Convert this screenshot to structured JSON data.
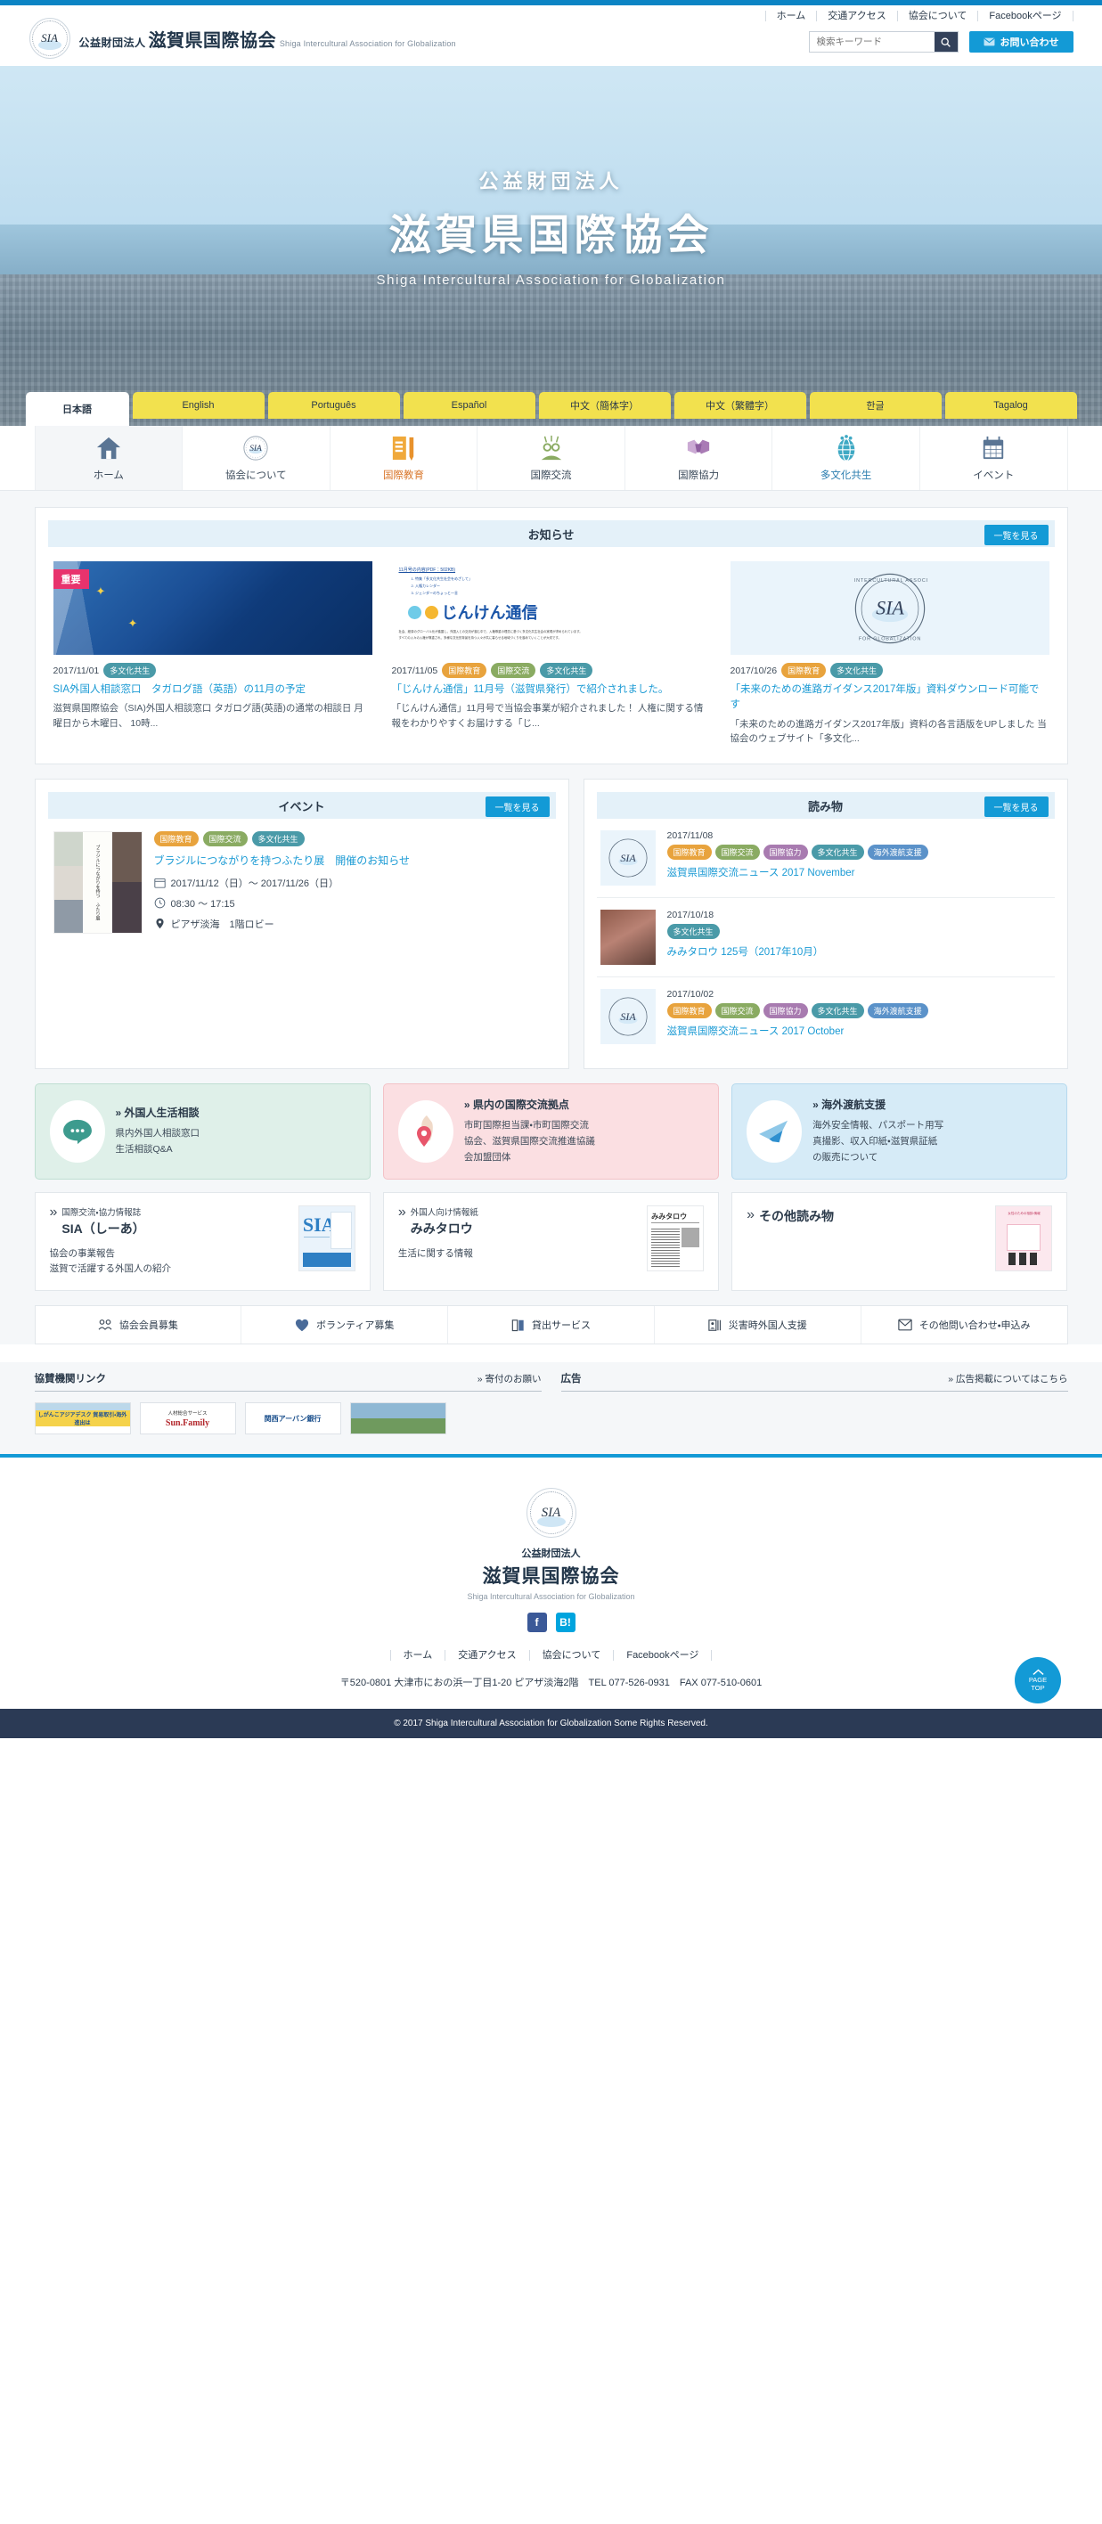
{
  "header": {
    "logo_l1_prefix": "公益財団法人",
    "logo_l1_main": "滋賀県国際協会",
    "logo_l2": "Shiga Intercultural Association for Globalization",
    "nav_links": [
      "ホーム",
      "交通アクセス",
      "協会について",
      "Facebookページ"
    ],
    "search_placeholder": "検索キーワード",
    "search_value": "",
    "contact_label": "お問い合わせ"
  },
  "hero": {
    "line1": "公益財団法人",
    "line2": "滋賀県国際協会",
    "line3": "Shiga Intercultural Association for Globalization",
    "languages": [
      {
        "label": "日本語",
        "active": true
      },
      {
        "label": "English",
        "active": false
      },
      {
        "label": "Português",
        "active": false
      },
      {
        "label": "Español",
        "active": false
      },
      {
        "label": "中文（簡体字）",
        "active": false
      },
      {
        "label": "中文（繁體字）",
        "active": false
      },
      {
        "label": "한글",
        "active": false
      },
      {
        "label": "Tagalog",
        "active": false
      }
    ]
  },
  "gnav": [
    {
      "label": "ホーム",
      "icon": "home-icon",
      "active": true
    },
    {
      "label": "協会について",
      "icon": "sia-seal-icon",
      "active": false
    },
    {
      "label": "国際教育",
      "icon": "book-pencil-icon",
      "active": false
    },
    {
      "label": "国際交流",
      "icon": "people-icon",
      "active": false
    },
    {
      "label": "国際協力",
      "icon": "handshake-icon",
      "active": false
    },
    {
      "label": "多文化共生",
      "icon": "globe-people-icon",
      "active": false
    },
    {
      "label": "イベント",
      "icon": "calendar-icon",
      "active": false
    }
  ],
  "news": {
    "title": "お知らせ",
    "see_all": "一覧を見る",
    "items": [
      {
        "badge": "重要",
        "date": "2017/11/01",
        "tags": [
          {
            "label": "多文化共生",
            "cls": "t-multi"
          }
        ],
        "title": "SIA外国人相談窓口　タガログ語（英語）の11月の予定",
        "desc": "滋賀県国際協会（SIA)外国人相談窓口 タガログ語(英語)の通常の相談日 月曜日から木曜日、 10時...",
        "thumb": "philippines-flag"
      },
      {
        "badge": "",
        "date": "2017/11/05",
        "tags": [
          {
            "label": "国際教育",
            "cls": "t-edu"
          },
          {
            "label": "国際交流",
            "cls": "t-exch"
          },
          {
            "label": "多文化共生",
            "cls": "t-multi"
          }
        ],
        "title": "「じんけん通信」11月号（滋賀県発行）で紹介されました。",
        "desc": "「じんけん通信」11月号で当協会事業が紹介されました！ 人権に関する情報をわかりやすくお届けする「じ...",
        "thumb": "jinken-newsletter"
      },
      {
        "badge": "",
        "date": "2017/10/26",
        "tags": [
          {
            "label": "国際教育",
            "cls": "t-edu"
          },
          {
            "label": "多文化共生",
            "cls": "t-multi"
          }
        ],
        "title": "「未来のための進路ガイダンス2017年版」資料ダウンロード可能です",
        "desc": "「未来のための進路ガイダンス2017年版」資料の各言語版をUPしました 当協会のウェブサイト「多文化...",
        "thumb": "sia-seal"
      }
    ]
  },
  "events": {
    "title": "イベント",
    "see_all": "一覧を見る",
    "item": {
      "tags": [
        {
          "label": "国際教育",
          "cls": "t-edu"
        },
        {
          "label": "国際交流",
          "cls": "t-exch"
        },
        {
          "label": "多文化共生",
          "cls": "t-multi"
        }
      ],
      "title": "ブラジルにつながりを持つふたり展　開催のお知らせ",
      "date": "2017/11/12（日）〜 2017/11/26（日）",
      "time": "08:30 〜 17:15",
      "place": "ピアザ淡海　1階ロビー"
    }
  },
  "reading": {
    "title": "読み物",
    "see_all": "一覧を見る",
    "items": [
      {
        "date": "2017/11/08",
        "tags": [
          {
            "label": "国際教育",
            "cls": "t-edu"
          },
          {
            "label": "国際交流",
            "cls": "t-exch"
          },
          {
            "label": "国際協力",
            "cls": "t-coop"
          },
          {
            "label": "多文化共生",
            "cls": "t-multi"
          },
          {
            "label": "海外渡航支援",
            "cls": "t-travel"
          }
        ],
        "title": "滋賀県国際交流ニュース 2017 November",
        "thumb": "sia-seal"
      },
      {
        "date": "2017/10/18",
        "tags": [
          {
            "label": "多文化共生",
            "cls": "t-multi"
          }
        ],
        "title": "みみタロウ 125号（2017年10月）",
        "thumb": "photo-people"
      },
      {
        "date": "2017/10/02",
        "tags": [
          {
            "label": "国際教育",
            "cls": "t-edu"
          },
          {
            "label": "国際交流",
            "cls": "t-exch"
          },
          {
            "label": "国際協力",
            "cls": "t-coop"
          },
          {
            "label": "多文化共生",
            "cls": "t-multi"
          },
          {
            "label": "海外渡航支援",
            "cls": "t-travel"
          }
        ],
        "title": "滋賀県国際交流ニュース 2017 October",
        "thumb": "sia-seal"
      }
    ]
  },
  "services": [
    {
      "title": "外国人生活相談",
      "lines": [
        "県内外国人相談窓口",
        "生活相談Q&A"
      ],
      "icon": "speech-bubble-icon"
    },
    {
      "title": "県内の国際交流拠点",
      "lines": [
        "市町国際担当課・市町国際交流",
        "協会、滋賀県国際交流推進協議",
        "会加盟団体"
      ],
      "icon": "map-pin-icon"
    },
    {
      "title": "海外渡航支援",
      "lines": [
        "海外安全情報、パスポート用写",
        "真撮影、収入印紙・滋賀県証紙",
        "の販売について"
      ],
      "icon": "airplane-icon"
    }
  ],
  "publications": [
    {
      "sup": "国際交流・協力情報誌",
      "title": "SIA（しーあ）",
      "lines": [
        "協会の事業報告",
        "滋賀で活躍する外国人の紹介"
      ],
      "cover": "sia-magazine"
    },
    {
      "sup": "外国人向け情報紙",
      "title": "みみタロウ",
      "lines": [
        "生活に関する情報"
      ],
      "cover": "mimitaro-paper"
    },
    {
      "sup": "",
      "title": "その他読み物",
      "lines": [],
      "cover": "other-booklet"
    }
  ],
  "quick_links": [
    {
      "label": "協会会員募集",
      "icon": "members-icon"
    },
    {
      "label": "ボランティア募集",
      "icon": "heart-icon"
    },
    {
      "label": "貸出サービス",
      "icon": "book-icon"
    },
    {
      "label": "災害時外国人支援",
      "icon": "id-card-icon"
    },
    {
      "label": "その他問い合わせ・申込み",
      "icon": "mail-icon"
    }
  ],
  "sponsors": {
    "left_title": "協賛機関リンク",
    "left_link": "寄付のお願い",
    "right_title": "広告",
    "right_link": "広告掲載についてはこちら",
    "left_items": [
      "しがんこアジアデスク 貿易取引・海外進出は",
      "人材総合サービス Sun.Family",
      "関西アーバン銀行",
      "滋賀の風景"
    ],
    "right_items": []
  },
  "footer": {
    "logo_l1": "公益財団法人",
    "logo_l2": "滋賀県国際協会",
    "logo_l3": "Shiga Intercultural Association for Globalization",
    "social": [
      {
        "label": "f",
        "color": "#3b5998",
        "name": "facebook-icon"
      },
      {
        "label": "B!",
        "color": "#00a4de",
        "name": "hatena-bookmark-icon"
      }
    ],
    "links": [
      "ホーム",
      "交通アクセス",
      "協会について",
      "Facebookページ"
    ],
    "address": "〒520-0801 大津市におの浜一丁目1-20 ピアザ淡海2階　TEL 077-526-0931　FAX 077-510-0601",
    "copyright": "© 2017 Shiga Intercultural Association for Globalization Some Rights Reserved.",
    "pagetop_l1": "PAGE",
    "pagetop_l2": "TOP"
  }
}
